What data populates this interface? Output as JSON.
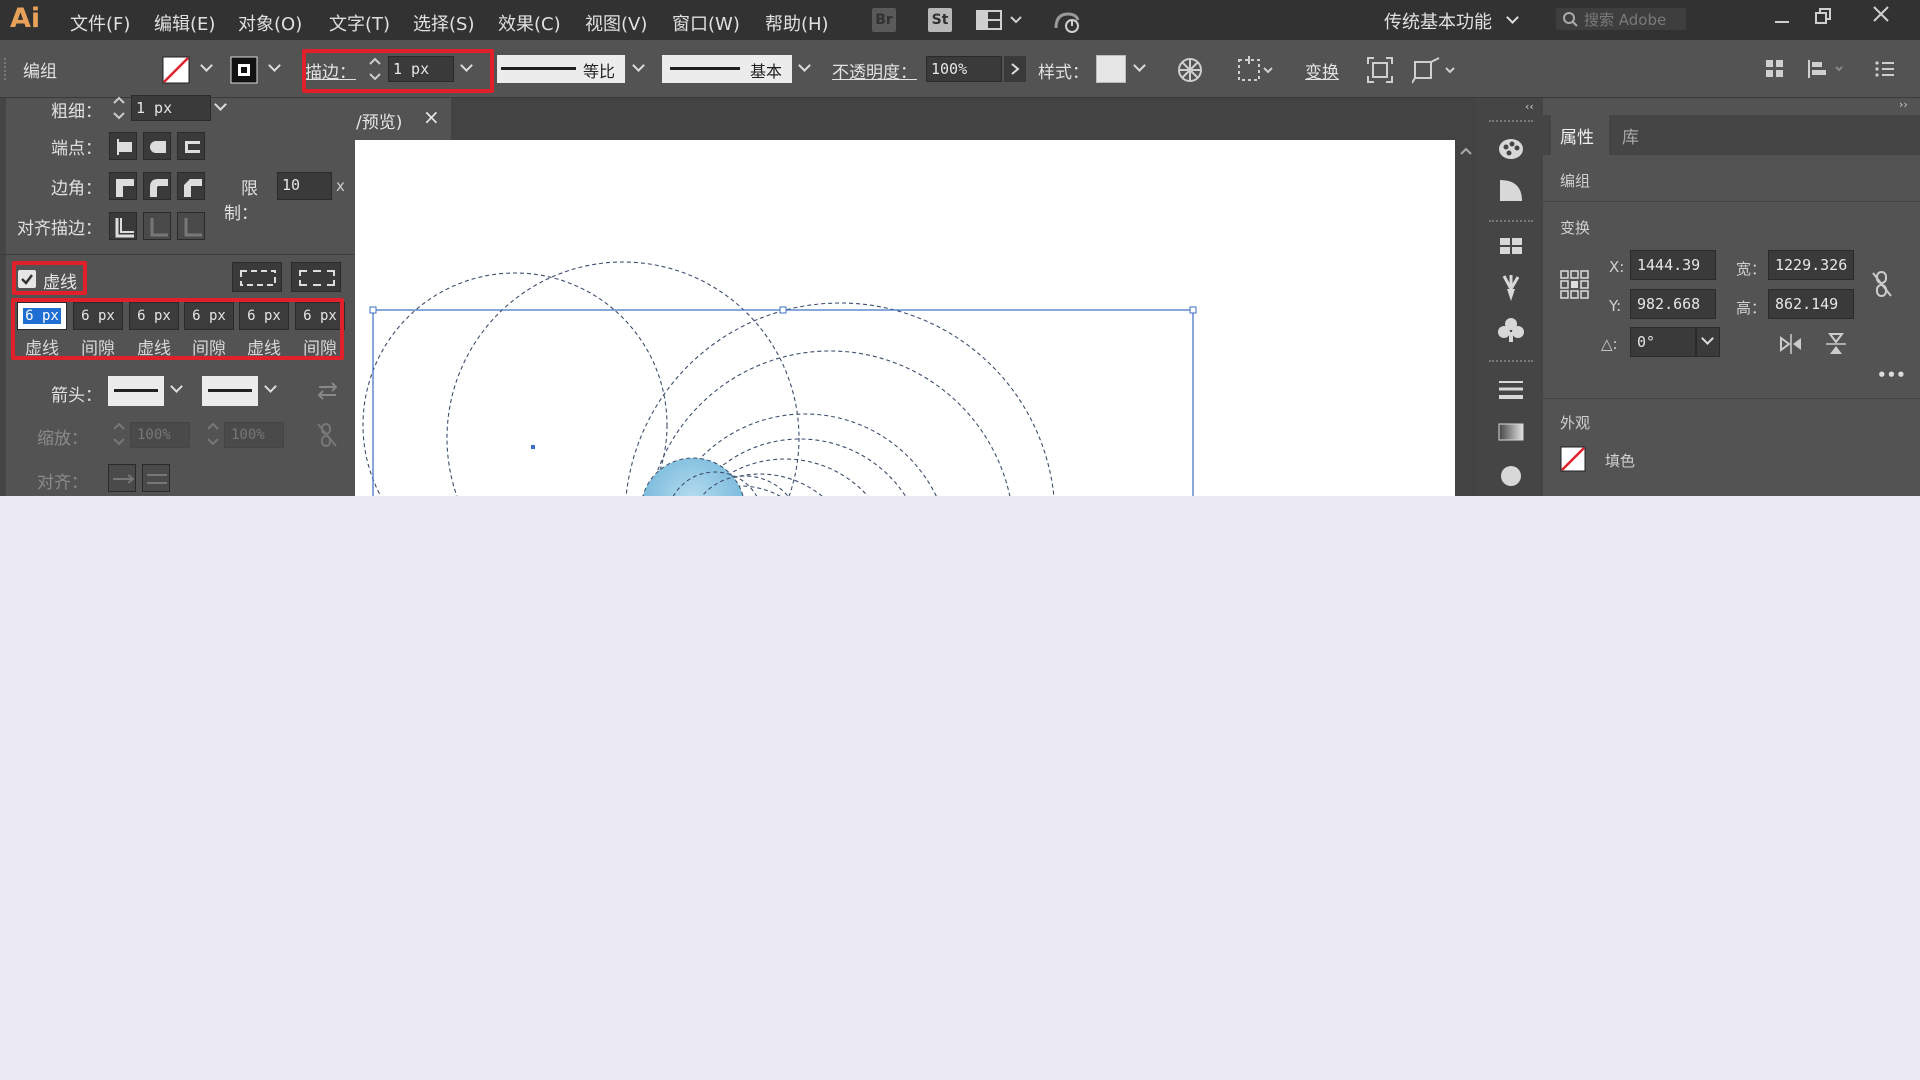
{
  "app": {
    "logo": "Ai"
  },
  "menu": [
    "文件(F)",
    "编辑(E)",
    "对象(O)",
    "文字(T)",
    "选择(S)",
    "效果(C)",
    "视图(V)",
    "窗口(W)",
    "帮助(H)"
  ],
  "bridge": {
    "br": "Br",
    "st": "St"
  },
  "workspace": "传统基本功能",
  "search": {
    "placeholder": "搜索 Adobe"
  },
  "control": {
    "group_label": "编组",
    "stroke_label": "描边：",
    "stroke_value": "1 px",
    "profile_label": "等比",
    "brush_label": "基本",
    "opacity_label": "不透明度：",
    "opacity_value": "100%",
    "style_label": "样式：",
    "transform_label": "变换"
  },
  "stroke_panel": {
    "weight_label": "粗细：",
    "weight_value": "1 px",
    "cap_label": "端点：",
    "corner_label": "边角：",
    "limit_label": "限制：",
    "limit_value": "10",
    "limit_unit": "x",
    "align_label": "对齐描边：",
    "dashed_label": "虚线",
    "dashed_checked": true,
    "dash_values": [
      "6 px",
      "6 px",
      "6 px",
      "6 px",
      "6 px",
      "6 px"
    ],
    "dash_labels": [
      "虚线",
      "间隙",
      "虚线",
      "间隙",
      "虚线",
      "间隙"
    ],
    "arrow_label": "箭头：",
    "scale_label": "缩放：",
    "scale_values": [
      "100%",
      "100%"
    ],
    "align2_label": "对齐："
  },
  "document": {
    "tab_title": "/预览)",
    "close": "×"
  },
  "properties": {
    "tab_properties": "属性",
    "tab_library": "库",
    "group_label": "编组",
    "transform_label": "变换",
    "x_label": "X:",
    "x_value": "1444.39",
    "y_label": "Y:",
    "y_value": "982.668",
    "w_label": "宽：",
    "w_value": "1229.326",
    "h_label": "高：",
    "h_value": "862.149",
    "angle_label": "△:",
    "angle_value": "0°",
    "appearance_label": "外观",
    "fill_label": "填色",
    "more": "•••"
  },
  "colors": {
    "highlight": "#e0202a",
    "selection": "#3a6fc4",
    "accent": "#1e6fd1"
  }
}
